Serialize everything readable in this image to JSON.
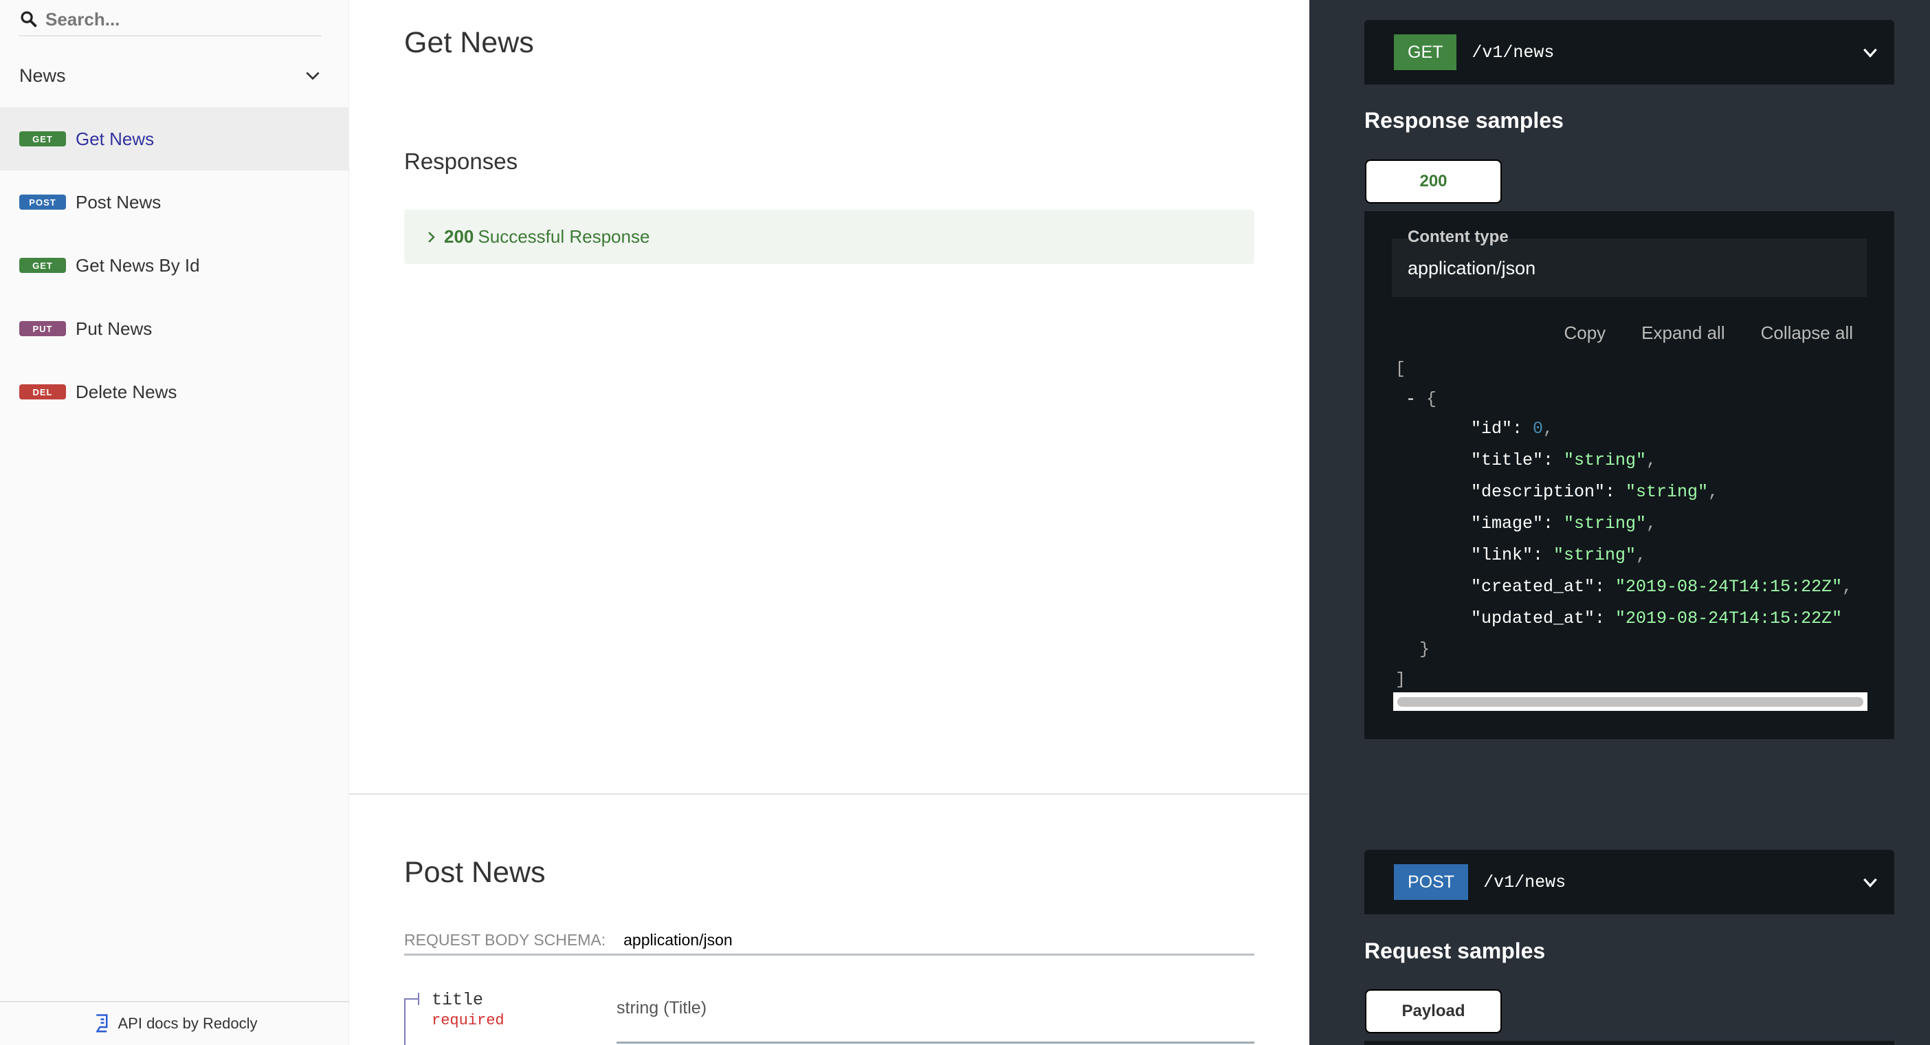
{
  "sidebar": {
    "search_placeholder": "Search...",
    "group": "News",
    "items": [
      {
        "method": "GET",
        "label": "Get News",
        "color": "#418540",
        "active": true
      },
      {
        "method": "POST",
        "label": "Post News",
        "color": "#306db0"
      },
      {
        "method": "GET",
        "label": "Get News By Id",
        "color": "#418540"
      },
      {
        "method": "PUT",
        "label": "Put News",
        "color": "#8b5079"
      },
      {
        "method": "DEL",
        "label": "Delete News",
        "color": "#c0403b"
      }
    ],
    "footer": "API docs by Redocly"
  },
  "get_news": {
    "title": "Get News",
    "responses_heading": "Responses",
    "response": {
      "code": "200",
      "label": "Successful Response"
    },
    "method": "GET",
    "path": "/v1/news",
    "samples_heading": "Response samples",
    "tab": "200",
    "content_type_label": "Content type",
    "content_type": "application/json",
    "actions": [
      "Copy",
      "Expand all",
      "Collapse all"
    ],
    "json": {
      "id": "0",
      "title": "\"string\"",
      "description": "\"string\"",
      "image": "\"string\"",
      "link": "\"string\"",
      "created_at": "\"2019-08-24T14:15:22Z\"",
      "updated_at": "\"2019-08-24T14:15:22Z\""
    }
  },
  "post_news": {
    "title": "Post News",
    "schema_label": "REQUEST BODY SCHEMA:",
    "schema_type": "application/json",
    "field": {
      "name": "title",
      "required": "required",
      "type": "string (Title)"
    },
    "method": "POST",
    "path": "/v1/news",
    "samples_heading": "Request samples",
    "tab": "Payload"
  }
}
